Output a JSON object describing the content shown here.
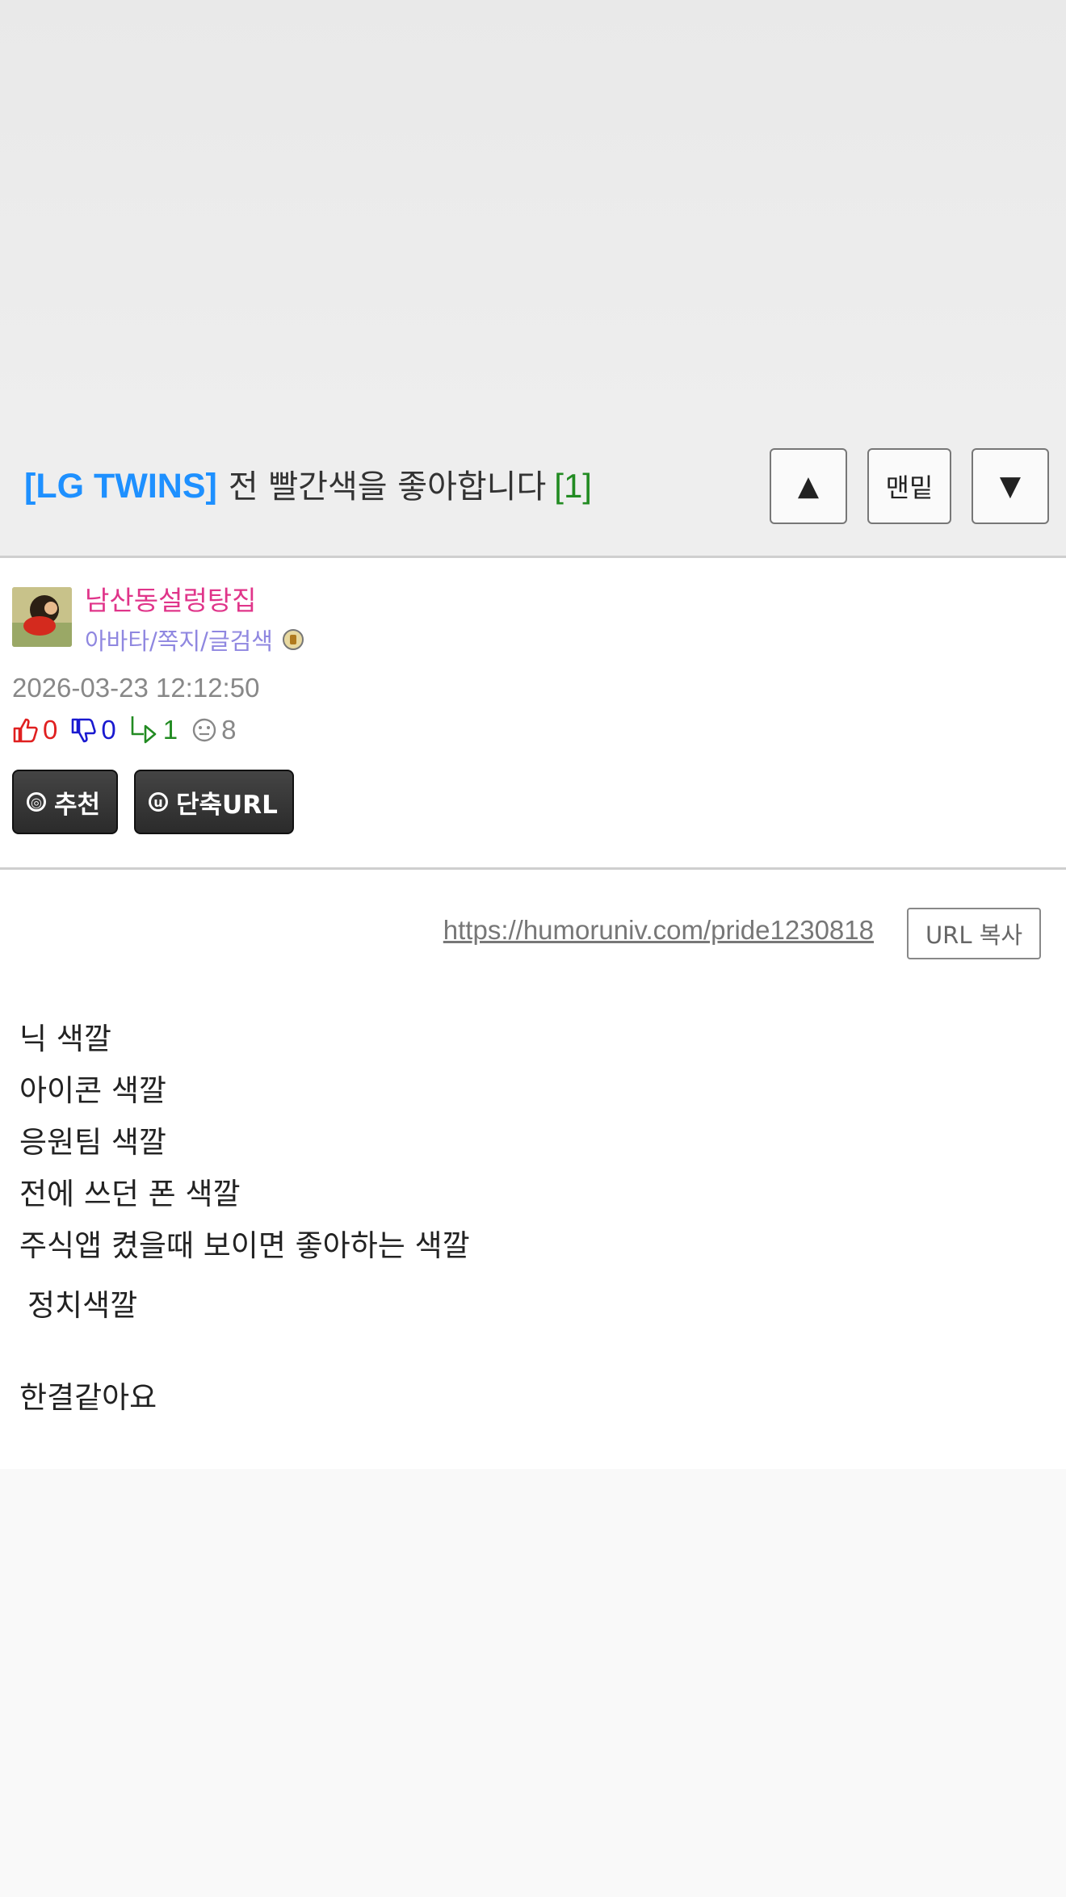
{
  "header": {
    "category": "[LG TWINS]",
    "subject": "전 빨간색을 좋아합니다",
    "comment_count": "[1]",
    "nav_up_label": "▲",
    "nav_bottom_label": "맨밑",
    "nav_down_label": "▼"
  },
  "author": {
    "nickname": "남산동설렁탕집",
    "sublinks": "아바타/쪽지/글검색",
    "date": "2026-03-23 12:12:50"
  },
  "stats": {
    "up": "0",
    "down": "0",
    "replies": "1",
    "views": "8"
  },
  "actions": {
    "recommend_label": "추천",
    "recommend_icon": "◎",
    "shorturl_label": "단축URL",
    "shorturl_icon": "u"
  },
  "post": {
    "url": "https://humoruniv.com/pride1230818",
    "copy_label": "URL 복사",
    "lines": [
      "닉 색깔",
      "아이콘 색깔",
      "응원팀 색깔",
      "전에 쓰던 폰 색깔",
      "주식앱 켰을때 보이면 좋아하는 색깔",
      "정치색깔",
      "한결같아요"
    ]
  },
  "colors": {
    "category": "#1e90ff",
    "nickname": "#e0358a",
    "sublinks": "#8f87e0",
    "up": "#e02020",
    "down": "#1a1ad0",
    "reply": "#228b22",
    "comment_count": "#228b22"
  }
}
